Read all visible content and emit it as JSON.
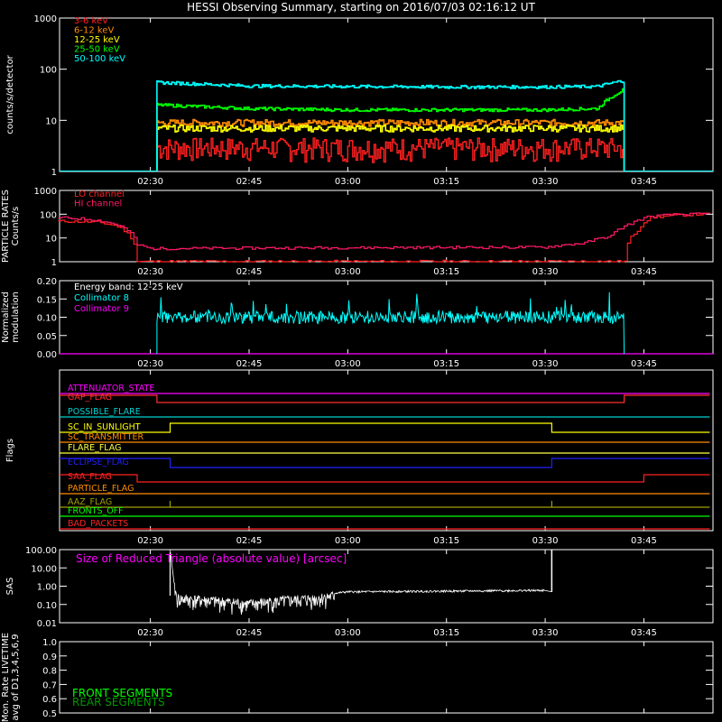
{
  "title": "HESSI Observing Summary, starting on 2016/07/03 02:16:12 UT",
  "time_ticks": [
    "02:30",
    "02:45",
    "03:00",
    "03:15",
    "03:30",
    "03:45"
  ],
  "colors": {
    "band_3_6": "#ff2020",
    "band_6_12": "#ff8c00",
    "band_12_25": "#ffff00",
    "band_25_50": "#00ff00",
    "band_50_100": "#00ffff",
    "lo_channel": "#ff2020",
    "hi_channel": "#ff1a66",
    "collimator_8": "#00ffff",
    "collimator_9": "#ff00ff"
  },
  "chart_data": [
    {
      "type": "line",
      "id": "counts",
      "ylabel": "counts/s/detector",
      "yscale": "log",
      "ylim": [
        1,
        1000
      ],
      "yticks": [
        "1",
        "10",
        "100",
        "1000"
      ],
      "x_unit": "UT",
      "series": [
        {
          "name": "3-6 keV",
          "color": "#ff2020",
          "x": [
            "02:31",
            "03:42"
          ],
          "y": [
            3,
            3
          ]
        },
        {
          "name": "6-12 keV",
          "color": "#ff8c00",
          "x": [
            "02:31",
            "03:42"
          ],
          "y": [
            9,
            9
          ]
        },
        {
          "name": "12-25 keV",
          "color": "#ffff00",
          "x": [
            "02:31",
            "03:42"
          ],
          "y": [
            7,
            7
          ]
        },
        {
          "name": "25-50 keV",
          "color": "#00ff00",
          "x": [
            "02:31",
            "02:45",
            "03:00",
            "03:15",
            "03:30",
            "03:38",
            "03:42"
          ],
          "y": [
            20,
            17,
            16,
            16,
            16,
            17,
            40
          ]
        },
        {
          "name": "50-100 keV",
          "color": "#00ffff",
          "x": [
            "02:31",
            "02:45",
            "03:00",
            "03:15",
            "03:30",
            "03:38",
            "03:42"
          ],
          "y": [
            55,
            47,
            46,
            45,
            45,
            46,
            60
          ]
        }
      ]
    },
    {
      "type": "line",
      "id": "particles",
      "ylabel": "PARTICLE RATES Counts/s",
      "yscale": "log",
      "ylim": [
        1,
        1000
      ],
      "yticks": [
        "1",
        "10",
        "100",
        "1000"
      ],
      "series": [
        {
          "name": "LO channel",
          "color": "#ff2020",
          "x": [
            "02:16",
            "02:22",
            "02:25",
            "02:27",
            "02:28",
            "03:40",
            "03:42",
            "03:44",
            "03:46",
            "03:50",
            "03:55"
          ],
          "y": [
            50,
            45,
            30,
            10,
            1,
            1,
            1,
            20,
            70,
            90,
            100
          ]
        },
        {
          "name": "HI channel",
          "color": "#ff1a66",
          "x": [
            "02:16",
            "02:21",
            "02:25",
            "02:28",
            "02:30",
            "03:00",
            "03:30",
            "03:36",
            "03:40",
            "03:43",
            "03:46",
            "03:50",
            "03:55"
          ],
          "y": [
            70,
            60,
            35,
            5,
            3.5,
            3.8,
            4,
            6,
            12,
            40,
            80,
            95,
            100
          ]
        }
      ]
    },
    {
      "type": "line",
      "id": "modulation",
      "ylabel": "Normalized modulation",
      "ylim": [
        0,
        0.2
      ],
      "yticks": [
        "0.00",
        "0.05",
        "0.10",
        "0.15",
        "0.20"
      ],
      "annotation": "Energy band: 12-25 keV",
      "series": [
        {
          "name": "Collimator 8",
          "color": "#00ffff",
          "x": [
            "02:31",
            "03:42"
          ],
          "y": [
            0.1,
            0.1
          ]
        },
        {
          "name": "Collimator 9",
          "color": "#ff00ff",
          "x": [
            "02:16",
            "03:55"
          ],
          "y": [
            0,
            0
          ]
        }
      ]
    },
    {
      "type": "line",
      "id": "flags",
      "ylabel": "Flags",
      "series": [
        {
          "name": "ATTENUATOR_STATE",
          "color": "#ff00ff",
          "x": [
            "02:16",
            "03:55"
          ],
          "y": [
            0,
            0
          ]
        },
        {
          "name": "GAP_FLAG",
          "color": "#ff3030",
          "x": [
            "02:16",
            "02:31",
            "02:31",
            "03:42",
            "03:42",
            "03:55"
          ],
          "y": [
            1,
            1,
            0,
            0,
            1,
            1
          ]
        },
        {
          "name": "POSSIBLE_FLARE",
          "color": "#00d0d0",
          "x": [
            "02:16",
            "03:55"
          ],
          "y": [
            0,
            0
          ]
        },
        {
          "name": "SC_IN_SUNLIGHT",
          "color": "#ffff00",
          "x": [
            "02:16",
            "02:33",
            "02:33",
            "03:31",
            "03:31",
            "03:55"
          ],
          "y": [
            0,
            0,
            1,
            1,
            0,
            0
          ]
        },
        {
          "name": "SC_TRANSMITTER",
          "color": "#ff8c00",
          "x": [
            "02:16",
            "03:55"
          ],
          "y": [
            0,
            0
          ]
        },
        {
          "name": "FLARE_FLAG",
          "color": "#ffff40",
          "x": [
            "02:16",
            "03:55"
          ],
          "y": [
            0,
            0
          ]
        },
        {
          "name": "ECLIPSE_FLAG",
          "color": "#2020ff",
          "x": [
            "02:16",
            "02:33",
            "02:33",
            "03:31",
            "03:31",
            "03:55"
          ],
          "y": [
            1,
            1,
            0,
            0,
            1,
            1
          ]
        },
        {
          "name": "SAA_FLAG",
          "color": "#ff2020",
          "x": [
            "02:16",
            "02:28",
            "02:28",
            "03:45",
            "03:45",
            "03:55"
          ],
          "y": [
            1,
            1,
            0,
            0,
            1,
            1
          ]
        },
        {
          "name": "PARTICLE_FLAG",
          "color": "#ff8c00",
          "x": [
            "02:16",
            "03:55"
          ],
          "y": [
            0,
            0
          ]
        },
        {
          "name": "AAZ_FLAG",
          "color": "#a0a000",
          "x": [
            "02:16",
            "02:33",
            "02:33",
            "02:33",
            "03:31",
            "03:31",
            "03:31",
            "03:55"
          ],
          "y": [
            0,
            0,
            1,
            0,
            0,
            1,
            0,
            0
          ]
        },
        {
          "name": "FRONTS_OFF",
          "color": "#00ff00",
          "x": [
            "02:16",
            "03:55"
          ],
          "y": [
            0,
            0
          ]
        },
        {
          "name": "BAD_PACKETS",
          "color": "#ff2020",
          "x": [
            "02:16",
            "03:55"
          ],
          "y": [
            0,
            0
          ]
        }
      ]
    },
    {
      "type": "line",
      "id": "sas",
      "ylabel": "SAS",
      "yscale": "log",
      "ylim": [
        0.01,
        100
      ],
      "yticks": [
        "0.01",
        "0.10",
        "1.00",
        "10.00",
        "100.00"
      ],
      "annotation": "Size of Reduced Triangle (absolute value) [arcsec]",
      "series": [
        {
          "name": "",
          "color": "#ffffff",
          "x": [
            "02:33",
            "02:34",
            "02:45",
            "02:55",
            "03:00",
            "03:15",
            "03:30",
            "03:31"
          ],
          "y": [
            3,
            0.3,
            0.15,
            0.3,
            0.5,
            0.55,
            0.6,
            100
          ]
        }
      ]
    },
    {
      "type": "line",
      "id": "livetime",
      "ylabel": "Mon. Rate LIVETIME avg of D1,3,4,5,6,9",
      "ylim": [
        0.5,
        1.0
      ],
      "yticks": [
        "0.5",
        "0.6",
        "0.7",
        "0.8",
        "0.9",
        "1.0"
      ],
      "series": [
        {
          "name": "FRONT SEGMENTS",
          "color": "#00ff00",
          "x": [],
          "y": []
        },
        {
          "name": "REAR SEGMENTS",
          "color": "#009900",
          "x": [],
          "y": []
        }
      ]
    }
  ]
}
